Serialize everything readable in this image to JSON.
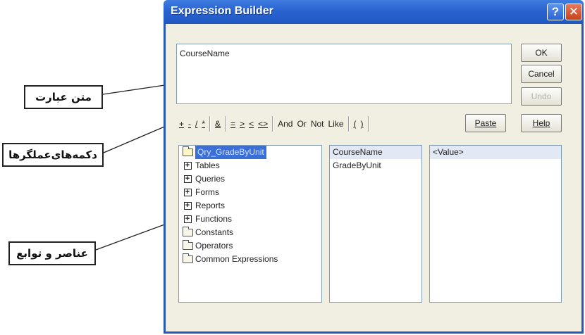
{
  "window": {
    "title": "Expression Builder",
    "help_glyph": "?",
    "close_glyph": "✕"
  },
  "expression": {
    "value": "CourseName"
  },
  "buttons": {
    "ok": "OK",
    "cancel": "Cancel",
    "undo": "Undo",
    "paste": "Paste",
    "help": "Help"
  },
  "operators": [
    "+",
    "-",
    "/",
    "*",
    "&",
    "=",
    ">",
    "<",
    "<>",
    "And",
    "Or",
    "Not",
    "Like",
    "(",
    ")"
  ],
  "elements_tree": [
    {
      "label": "Qry_GradeByUnit",
      "icon": "open-folder-icon",
      "selected": true
    },
    {
      "label": "Tables",
      "icon": "expand-plus-icon"
    },
    {
      "label": "Queries",
      "icon": "expand-plus-icon"
    },
    {
      "label": "Forms",
      "icon": "expand-plus-icon"
    },
    {
      "label": "Reports",
      "icon": "expand-plus-icon"
    },
    {
      "label": "Functions",
      "icon": "expand-plus-icon"
    },
    {
      "label": "Constants",
      "icon": "folder-icon"
    },
    {
      "label": "Operators",
      "icon": "folder-icon"
    },
    {
      "label": "Common Expressions",
      "icon": "folder-icon"
    }
  ],
  "fields_list": [
    {
      "label": "CourseName",
      "selected": true
    },
    {
      "label": "GradeByUnit"
    }
  ],
  "values_list": [
    {
      "label": "<Value>",
      "selected": true
    }
  ],
  "annotations": {
    "expression_text": "متن عبارت",
    "operator_buttons": "دکمه‌های‌عملگرها",
    "elements_functions": "عناصر و توابع"
  },
  "colors": {
    "titlebar": "#2a62d0",
    "selection": "#3a6fd8",
    "dialog_face": "#f1efe2"
  }
}
